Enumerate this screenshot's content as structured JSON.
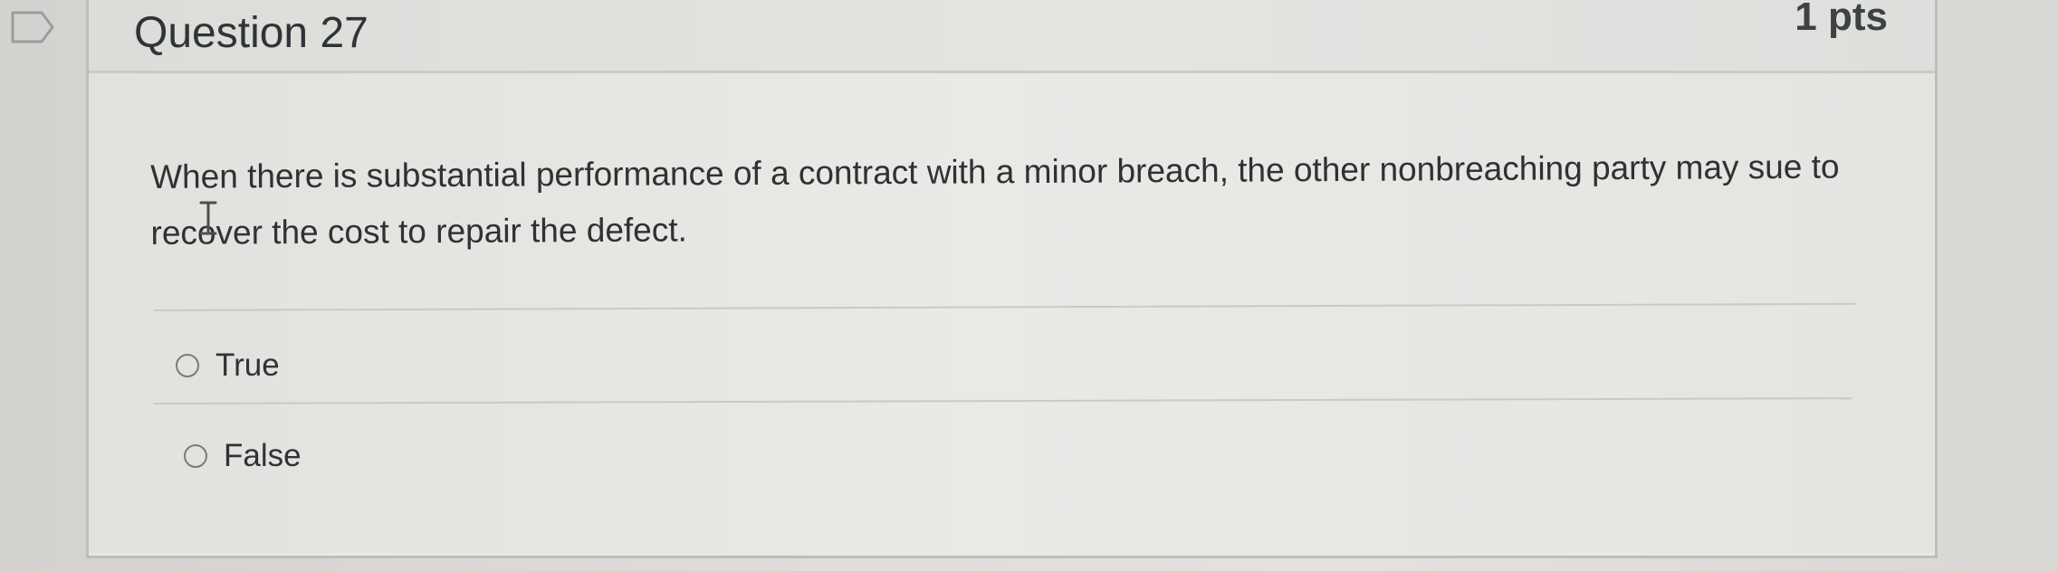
{
  "question": {
    "title": "Question 27",
    "points": "1 pts",
    "text": "When there is substantial performance of a contract with a minor breach, the other nonbreaching party may sue to recover the cost to repair the defect.",
    "flag_icon": "bookmark-flag-icon"
  },
  "answers": [
    {
      "label": "True",
      "selected": false
    },
    {
      "label": "False",
      "selected": false
    }
  ],
  "colors": {
    "text": "#2f3336",
    "border": "#bdbdba",
    "background": "#e8e8e5"
  }
}
